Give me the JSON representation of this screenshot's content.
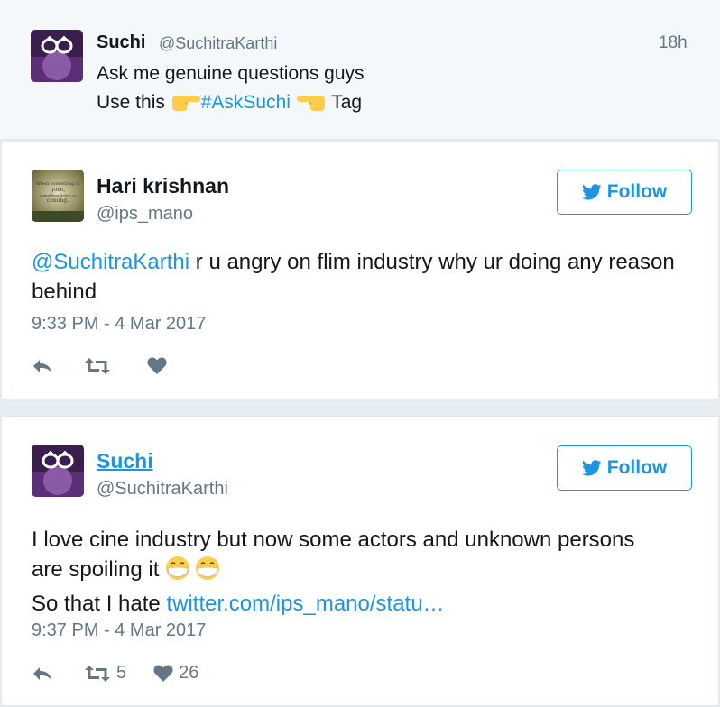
{
  "parent_tweet": {
    "name": "Suchi",
    "handle": "@SuchitraKarthi",
    "time": "18h",
    "line1": "Ask me genuine questions guys",
    "line2_prefix": "Use this",
    "hashtag": "#AskSuchi",
    "line2_suffix": "Tag"
  },
  "tweets": [
    {
      "name": "Hari krishnan",
      "handle": "@ips_mano",
      "follow_label": "Follow",
      "mention": "@SuchitraKarthi",
      "text": " r u angry on flim industry why ur doing any reason behind",
      "timestamp": "9:33 PM - 4 Mar 2017",
      "avatar_text": [
        "When something is",
        "gone,",
        "something better is",
        "coming."
      ],
      "actions": {
        "retweets": "",
        "likes": ""
      }
    },
    {
      "name": "Suchi",
      "handle": "@SuchitraKarthi",
      "follow_label": "Follow",
      "text_line1": "I love cine industry but now some actors and unknown persons",
      "text_line2": "are spoiling it",
      "text_line3_prefix": "So that I hate ",
      "link": "twitter.com/ips_mano/statu…",
      "timestamp": "9:37 PM - 4 Mar 2017",
      "actions": {
        "retweets": "5",
        "likes": "26"
      }
    }
  ],
  "colors": {
    "accent": "#1b95e0",
    "muted": "#657786",
    "emoji": "#ffcc4d"
  }
}
